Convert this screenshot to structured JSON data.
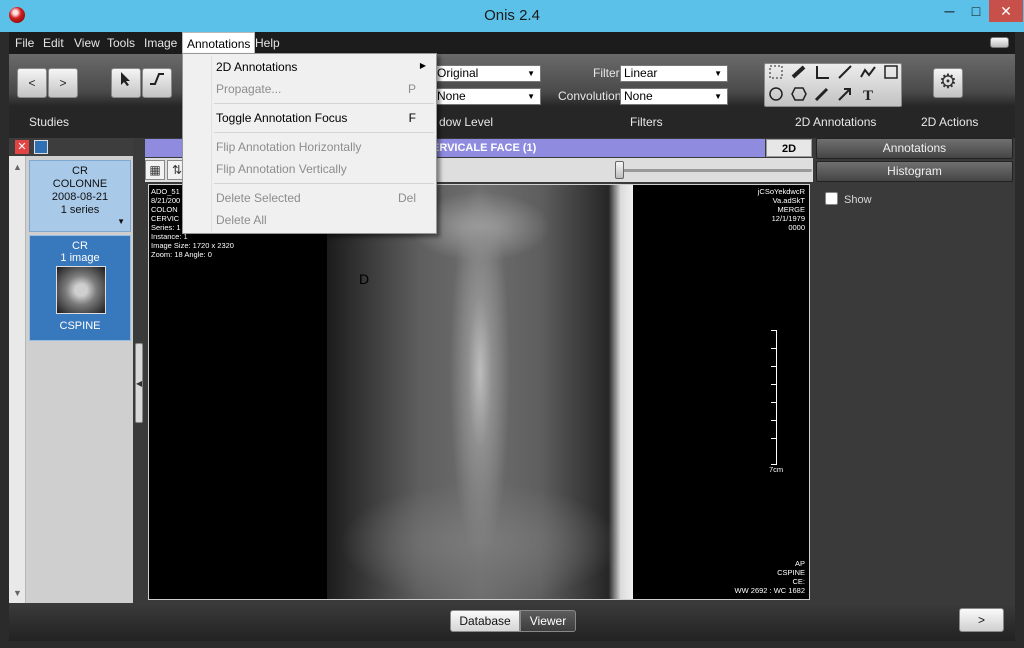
{
  "window": {
    "title": "Onis 2.4",
    "minimize": "─",
    "maximize": "□",
    "close": "✕"
  },
  "menubar": {
    "items": [
      "File",
      "Edit",
      "View",
      "Tools",
      "Image",
      "Annotations",
      "Help"
    ]
  },
  "toolbar": {
    "nav_prev": "<",
    "nav_next": ">",
    "studies_label": "Studies",
    "window_level_label": "dow Level",
    "filters_label": "Filters",
    "annotations_label": "2D Annotations",
    "actions_label": "2D Actions",
    "window_select_1": "Original",
    "window_select_2": "None",
    "filter_label": "Filter",
    "filter_value": "Linear",
    "convolution_label": "Convolution",
    "convolution_value": "None",
    "text_tool": "T"
  },
  "annotations_menu": {
    "items": [
      {
        "label": "2D Annotations",
        "shortcut": "",
        "enabled": true,
        "submenu": true
      },
      {
        "label": "Propagate...",
        "shortcut": "P",
        "enabled": false
      },
      {
        "label": "Toggle Annotation Focus",
        "shortcut": "F",
        "enabled": true
      },
      {
        "label": "Flip Annotation Horizontally",
        "shortcut": "",
        "enabled": false
      },
      {
        "label": "Flip Annotation Vertically",
        "shortcut": "",
        "enabled": false
      },
      {
        "label": "Delete Selected",
        "shortcut": "Del",
        "enabled": false
      },
      {
        "label": "Delete All",
        "shortcut": "",
        "enabled": false
      }
    ]
  },
  "studies_panel": {
    "study": {
      "modality": "CR",
      "name": "COLONNE",
      "date": "2008-08-21",
      "series": "1 series"
    },
    "series": {
      "modality": "CR",
      "images": "1 image",
      "label": "CSPINE"
    }
  },
  "viewer": {
    "title": "ERVICALE FACE (1)",
    "mode": "2D",
    "overlay_tl": [
      "ADO_51",
      "8/21/200",
      "COLON",
      "CERVIC",
      "Series: 1",
      "Instance: 1",
      "Image Size: 1720 x 2320",
      "Zoom: 18 Angle: 0"
    ],
    "overlay_tr": [
      "jCSoYekdwcR",
      "Va.adSkT",
      "MERGE",
      "12/1/1979",
      "0000"
    ],
    "overlay_br": [
      "AP",
      "CSPINE",
      "CE:",
      "WW 2692 : WC 1682"
    ],
    "ruler_label": "7cm",
    "marker": "D",
    "slider_value": 0
  },
  "right_panel": {
    "annotations_btn": "Annotations",
    "histogram_btn": "Histogram",
    "show_label": "Show"
  },
  "statusbar": {
    "database": "Database",
    "viewer": "Viewer",
    "next": ">"
  }
}
